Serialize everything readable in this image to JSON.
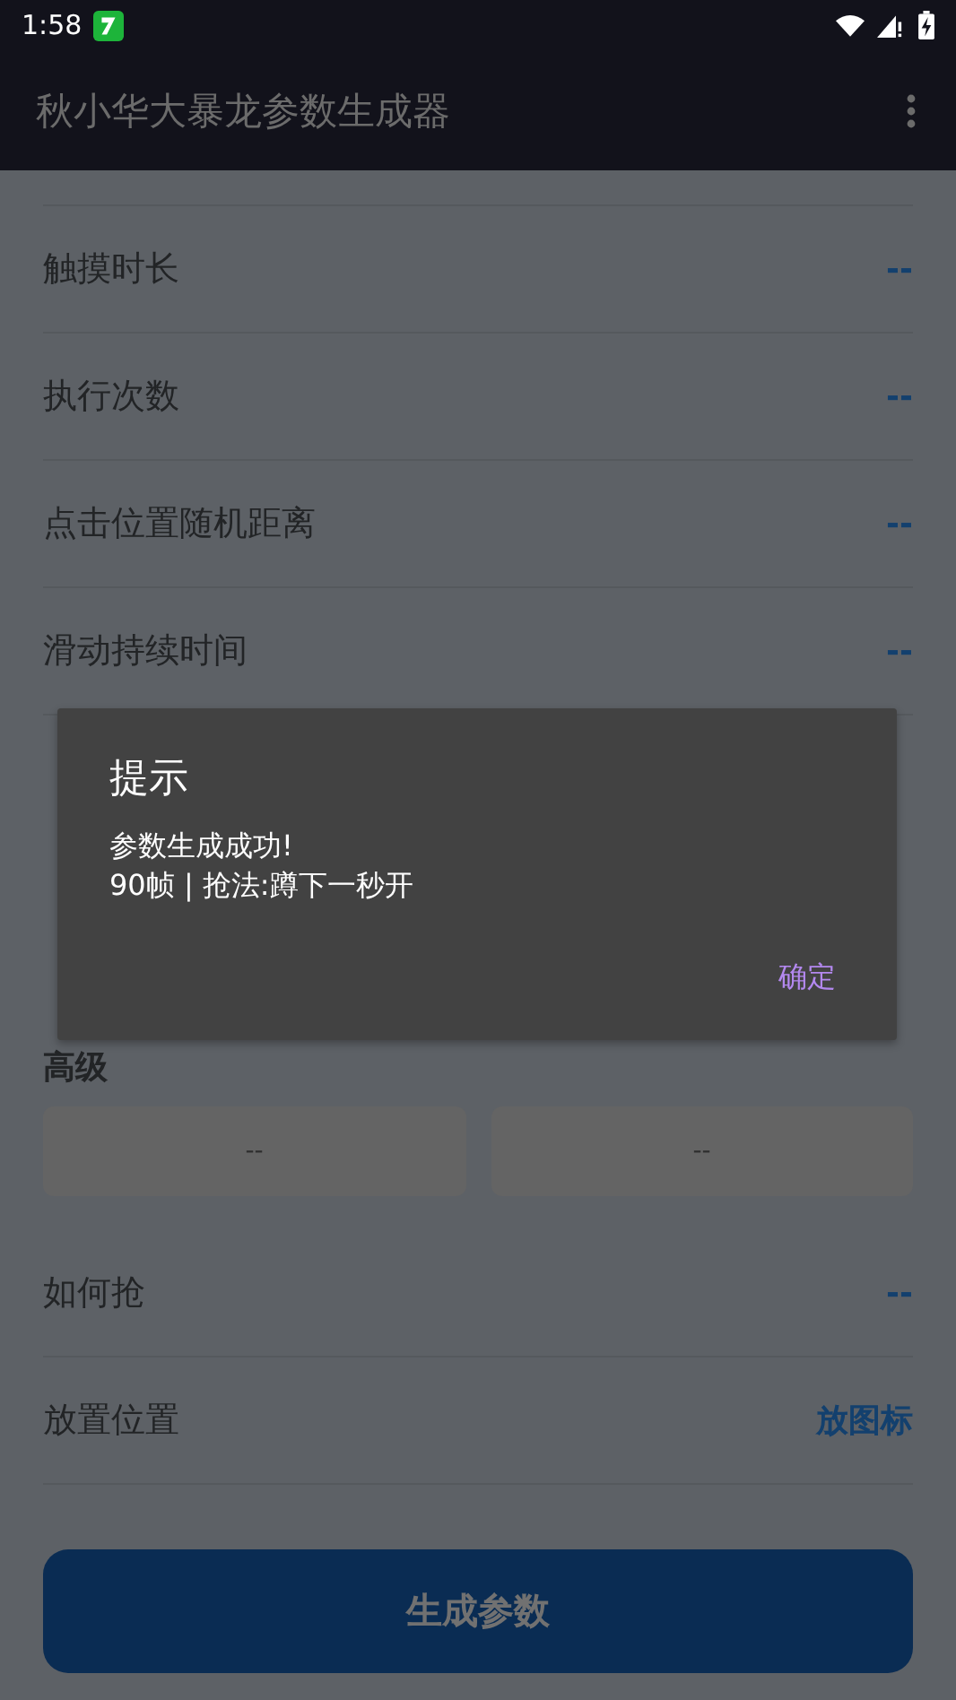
{
  "status_bar": {
    "time": "1:58"
  },
  "app_bar": {
    "title": "秋小华大暴龙参数生成器"
  },
  "settings": [
    {
      "label": "触摸时长",
      "value": "--"
    },
    {
      "label": "执行次数",
      "value": "--"
    },
    {
      "label": "点击位置随机距离",
      "value": "--"
    },
    {
      "label": "滑动持续时间",
      "value": "--"
    }
  ],
  "advanced": {
    "heading": "高级",
    "buttons": [
      "--",
      "--"
    ]
  },
  "options": [
    {
      "label": "如何抢",
      "value": "--"
    },
    {
      "label": "放置位置",
      "value": "放图标"
    }
  ],
  "generate_button": "生成参数",
  "dialog": {
    "title": "提示",
    "lines": [
      "参数生成成功!",
      "90帧 | 抢法:蹲下一秒开"
    ],
    "button": "确定"
  }
}
